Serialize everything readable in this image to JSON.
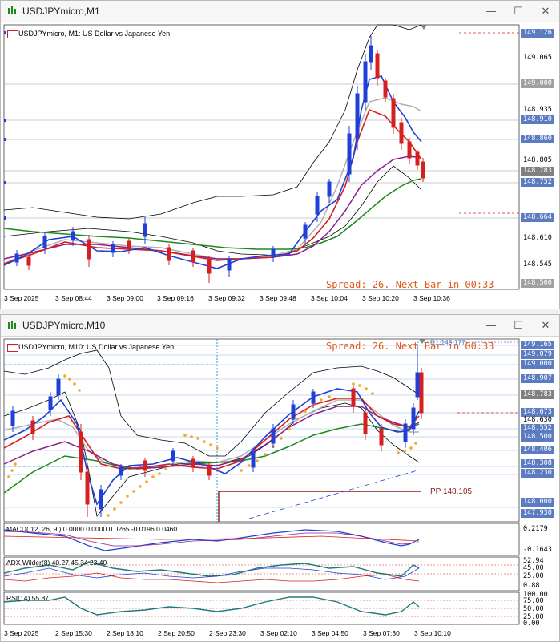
{
  "window1": {
    "title": "USDJPYmicro,M1",
    "chart_label": "USDJPYmicro, M1:  US Dollar vs Japanese Yen",
    "spread_text": "Spread: 26. Next Bar in 00:33",
    "price_levels": [
      "149.126",
      "149.065",
      "149.000",
      "148.935",
      "148.910",
      "148.870",
      "148.860",
      "148.805",
      "148.783",
      "148.752",
      "148.740",
      "148.675",
      "148.664",
      "148.610",
      "148.545",
      "148.500"
    ],
    "time_labels": [
      "3 Sep 2025",
      "3 Sep 08:44",
      "3 Sep 09:00",
      "3 Sep 09:16",
      "3 Sep 09:32",
      "3 Sep 09:48",
      "3 Sep 10:04",
      "3 Sep 10:20",
      "3 Sep 10:36"
    ]
  },
  "window2": {
    "title": "USDJPYmicro,M10",
    "chart_label": "USDJPYmicro, M10:  US Dollar vs Japanese Yen",
    "spread_text": "Spread: 26. Next Bar in 00:33",
    "r1_label": "R1 149.177",
    "pp_label": "PP 148.105",
    "price_levels": [
      "149.165",
      "149.079",
      "149.000",
      "148.907",
      "148.915",
      "148.783",
      "148.673",
      "148.630",
      "148.552",
      "148.500",
      "148.445",
      "148.406",
      "148.308",
      "148.230",
      "148.165",
      "148.000",
      "147.930"
    ],
    "macd_label": "MACD( 12, 26, 9 ) 0.0000 0.0000 0.0265 -0.0196 0.0460",
    "macd_levels": [
      "0.2179",
      "-0.1643"
    ],
    "adx_label": "ADX Wilder(8) 40.27 45.34 23.40",
    "adx_levels": [
      "52.94",
      "45.00",
      "25.00",
      "0.88"
    ],
    "rsi_label": "RSI(14) 55.87",
    "rsi_levels": [
      "100.00",
      "75.00",
      "50.00",
      "25.00",
      "0.00"
    ],
    "time_labels": [
      "3 Sep 2025",
      "2 Sep 15:30",
      "2 Sep 18:10",
      "2 Sep 20:50",
      "2 Sep 23:30",
      "3 Sep 02:10",
      "3 Sep 04:50",
      "3 Sep 07:30",
      "3 Sep 10:10"
    ]
  },
  "window_buttons": {
    "minimize": "—",
    "maximize": "☐",
    "close": "✕"
  },
  "colors": {
    "bull": "#1f3fd6",
    "bear": "#d62020",
    "ma_fast": "#1f3fd6",
    "ma_mid": "#d62020",
    "ma_slow": "#8a1f8a",
    "ma_long": "#1b8a1b",
    "silver": "#b0b0b0",
    "psar": "#f5a623",
    "grid": "#c8c8c8",
    "axis_blue": "#5b7cc1",
    "axis_red": "#e02020"
  }
}
